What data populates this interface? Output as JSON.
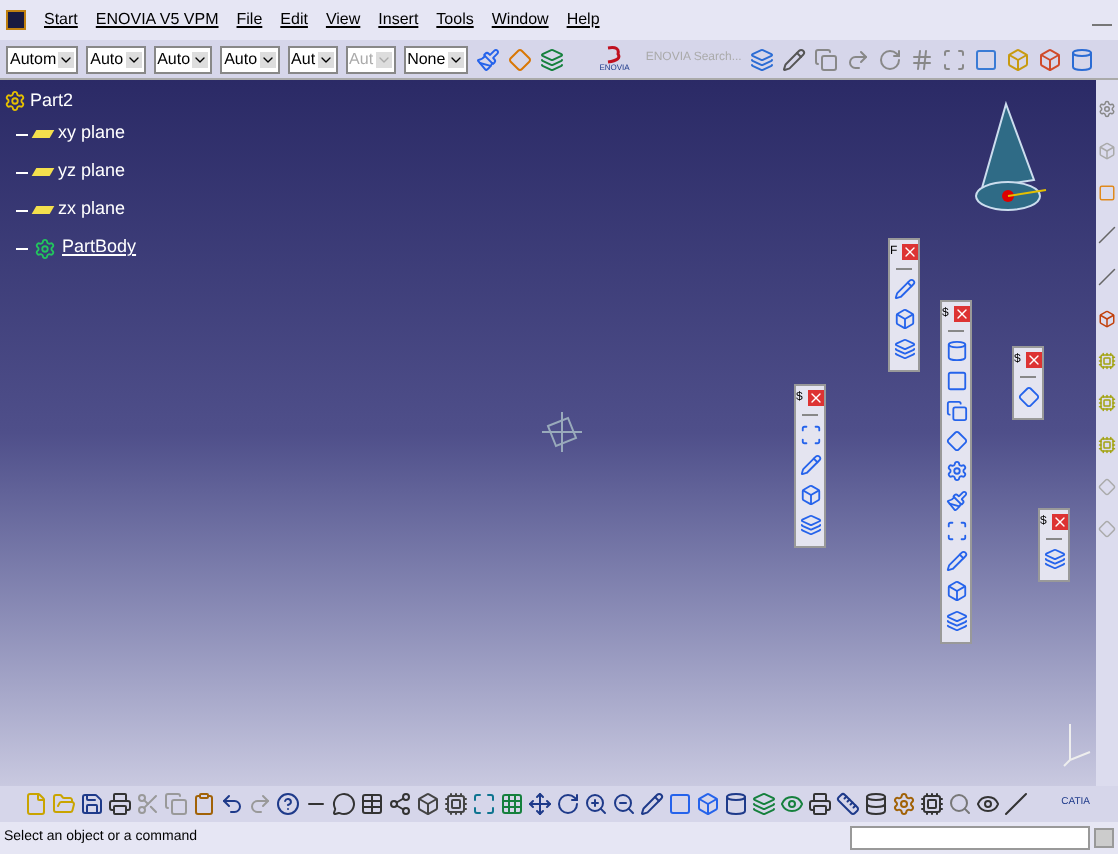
{
  "menu": [
    {
      "label": "Start"
    },
    {
      "label": "ENOVIA V5 VPM"
    },
    {
      "label": "File"
    },
    {
      "label": "Edit"
    },
    {
      "label": "View"
    },
    {
      "label": "Insert"
    },
    {
      "label": "Tools"
    },
    {
      "label": "Window"
    },
    {
      "label": "Help"
    }
  ],
  "toolbar": {
    "dropdowns": [
      {
        "value": "Autom",
        "disabled": false
      },
      {
        "value": "Auto",
        "disabled": false
      },
      {
        "value": "Auto",
        "disabled": false
      },
      {
        "value": "Auto",
        "disabled": false
      },
      {
        "value": "Aut",
        "disabled": false
      },
      {
        "value": "Aut",
        "disabled": true
      },
      {
        "value": "None",
        "disabled": false
      }
    ],
    "enovia_logo": "ENOVIA",
    "search_label": "ENOVIA Search..."
  },
  "tree": {
    "label": "Part2",
    "children": [
      {
        "label": "xy plane",
        "kind": "plane"
      },
      {
        "label": "yz plane",
        "kind": "plane"
      },
      {
        "label": "zx plane",
        "kind": "plane"
      },
      {
        "label": "PartBody",
        "kind": "body"
      }
    ]
  },
  "floating_toolbars": [
    {
      "title": "F"
    },
    {
      "title": "$"
    },
    {
      "title": "$"
    },
    {
      "title": "$"
    },
    {
      "title": "$"
    }
  ],
  "catia_logo": "CATIA",
  "status_bar": {
    "message": "Select an object or a command"
  }
}
